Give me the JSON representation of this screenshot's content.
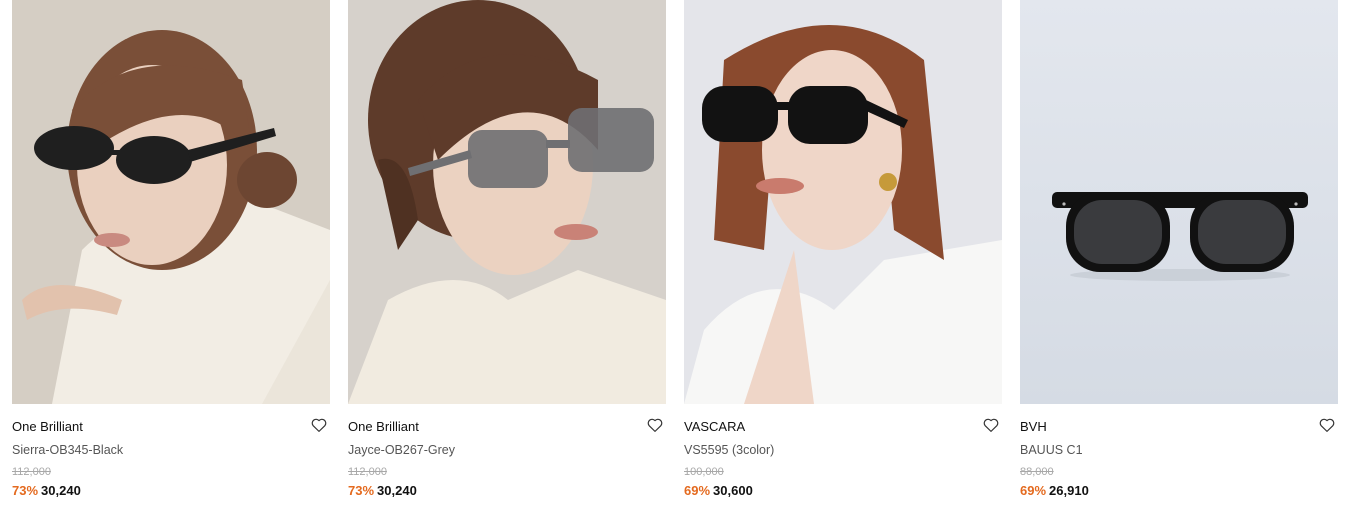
{
  "products": [
    {
      "brand": "One Brilliant",
      "name": "Sierra-OB345-Black",
      "original_price": "112,000",
      "discount": "73%",
      "price": "30,240",
      "image_alt": "Model wearing black oval sunglasses"
    },
    {
      "brand": "One Brilliant",
      "name": "Jayce-OB267-Grey",
      "original_price": "112,000",
      "discount": "73%",
      "price": "30,240",
      "image_alt": "Model wearing grey translucent sunglasses"
    },
    {
      "brand": "VASCARA",
      "name": "VS5595 (3color)",
      "original_price": "100,000",
      "discount": "69%",
      "price": "30,600",
      "image_alt": "Model wearing black sunglasses"
    },
    {
      "brand": "BVH",
      "name": "BAUUS C1",
      "original_price": "88,000",
      "discount": "69%",
      "price": "26,910",
      "image_alt": "Black sunglasses product shot"
    }
  ],
  "icons": {
    "wishlist": "heart-outline-icon"
  },
  "colors": {
    "discount": "#e46a1f",
    "original_price": "#a8a8a8",
    "brand": "#111111",
    "name": "#555555"
  }
}
